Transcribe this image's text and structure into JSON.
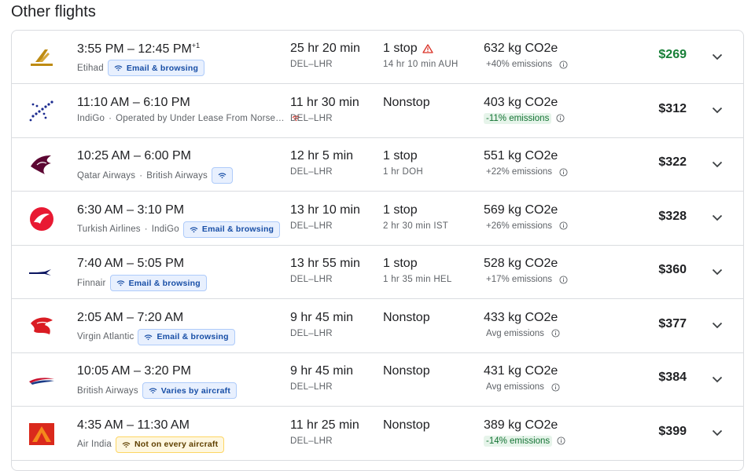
{
  "section": {
    "title": "Other flights"
  },
  "flights": [
    {
      "times": "3:55 PM – 12:45 PM",
      "day_offset": "+1",
      "airline": "Etihad",
      "operator": "",
      "extra_airline": "",
      "chip": "Email & browsing",
      "chip_type": "wifi",
      "duration": "25 hr 20 min",
      "route": "DEL–LHR",
      "stops": "1 stop",
      "warning": true,
      "layover": "14 hr 10 min AUH",
      "co2": "632 kg CO2e",
      "emissions": "+40% emissions",
      "emissions_type": "normal",
      "price": "$269",
      "price_best": true,
      "logo": "etihad-logo"
    },
    {
      "times": "11:10 AM – 6:10 PM",
      "day_offset": "",
      "airline": "IndiGo",
      "operator": "Operated by Under Lease From Norse…",
      "extra_airline": "",
      "chip": "",
      "chip_type": "wifi-red",
      "duration": "11 hr 30 min",
      "route": "DEL–LHR",
      "stops": "Nonstop",
      "warning": false,
      "layover": "",
      "co2": "403 kg CO2e",
      "emissions": "-11% emissions",
      "emissions_type": "low",
      "price": "$312",
      "price_best": false,
      "logo": "indigo-logo"
    },
    {
      "times": "10:25 AM – 6:00 PM",
      "day_offset": "",
      "airline": "Qatar Airways",
      "operator": "",
      "extra_airline": "British Airways",
      "chip": "",
      "chip_type": "wifi-only",
      "duration": "12 hr 5 min",
      "route": "DEL–LHR",
      "stops": "1 stop",
      "warning": false,
      "layover": "1 hr DOH",
      "co2": "551 kg CO2e",
      "emissions": "+22% emissions",
      "emissions_type": "normal",
      "price": "$322",
      "price_best": false,
      "logo": "qatar-logo"
    },
    {
      "times": "6:30 AM – 3:10 PM",
      "day_offset": "",
      "airline": "Turkish Airlines",
      "operator": "",
      "extra_airline": "IndiGo",
      "chip": "Email & browsing",
      "chip_type": "wifi",
      "duration": "13 hr 10 min",
      "route": "DEL–LHR",
      "stops": "1 stop",
      "warning": false,
      "layover": "2 hr 30 min IST",
      "co2": "569 kg CO2e",
      "emissions": "+26% emissions",
      "emissions_type": "normal",
      "price": "$328",
      "price_best": false,
      "logo": "turkish-logo"
    },
    {
      "times": "7:40 AM – 5:05 PM",
      "day_offset": "",
      "airline": "Finnair",
      "operator": "",
      "extra_airline": "",
      "chip": "Email & browsing",
      "chip_type": "wifi",
      "duration": "13 hr 55 min",
      "route": "DEL–LHR",
      "stops": "1 stop",
      "warning": false,
      "layover": "1 hr 35 min HEL",
      "co2": "528 kg CO2e",
      "emissions": "+17% emissions",
      "emissions_type": "normal",
      "price": "$360",
      "price_best": false,
      "logo": "finnair-logo"
    },
    {
      "times": "2:05 AM – 7:20 AM",
      "day_offset": "",
      "airline": "Virgin Atlantic",
      "operator": "",
      "extra_airline": "",
      "chip": "Email & browsing",
      "chip_type": "wifi",
      "duration": "9 hr 45 min",
      "route": "DEL–LHR",
      "stops": "Nonstop",
      "warning": false,
      "layover": "",
      "co2": "433 kg CO2e",
      "emissions": "Avg emissions",
      "emissions_type": "normal",
      "price": "$377",
      "price_best": false,
      "logo": "virgin-logo"
    },
    {
      "times": "10:05 AM – 3:20 PM",
      "day_offset": "",
      "airline": "British Airways",
      "operator": "",
      "extra_airline": "",
      "chip": "Varies by aircraft",
      "chip_type": "wifi",
      "duration": "9 hr 45 min",
      "route": "DEL–LHR",
      "stops": "Nonstop",
      "warning": false,
      "layover": "",
      "co2": "431 kg CO2e",
      "emissions": "Avg emissions",
      "emissions_type": "normal",
      "price": "$384",
      "price_best": false,
      "logo": "british-airways-logo"
    },
    {
      "times": "4:35 AM – 11:30 AM",
      "day_offset": "",
      "airline": "Air India",
      "operator": "",
      "extra_airline": "",
      "chip": "Not on every aircraft",
      "chip_type": "warn",
      "duration": "11 hr 25 min",
      "route": "DEL–LHR",
      "stops": "Nonstop",
      "warning": false,
      "layover": "",
      "co2": "389 kg CO2e",
      "emissions": "-14% emissions",
      "emissions_type": "low",
      "price": "$399",
      "price_best": false,
      "logo": "air-india-logo"
    }
  ],
  "colors": {
    "best_price": "#188038",
    "chip_bg": "#e8f0fe",
    "chip_text": "#174ea6",
    "warn_chip_bg": "#fef7e0",
    "low_emission_bg": "#e6f4ea",
    "low_emission_text": "#137333",
    "warning_icon": "#d93025"
  },
  "icons": {
    "wifi": "wifi-icon",
    "info": "info-icon",
    "expand": "chevron-down-icon",
    "warning": "warning-triangle-icon"
  }
}
